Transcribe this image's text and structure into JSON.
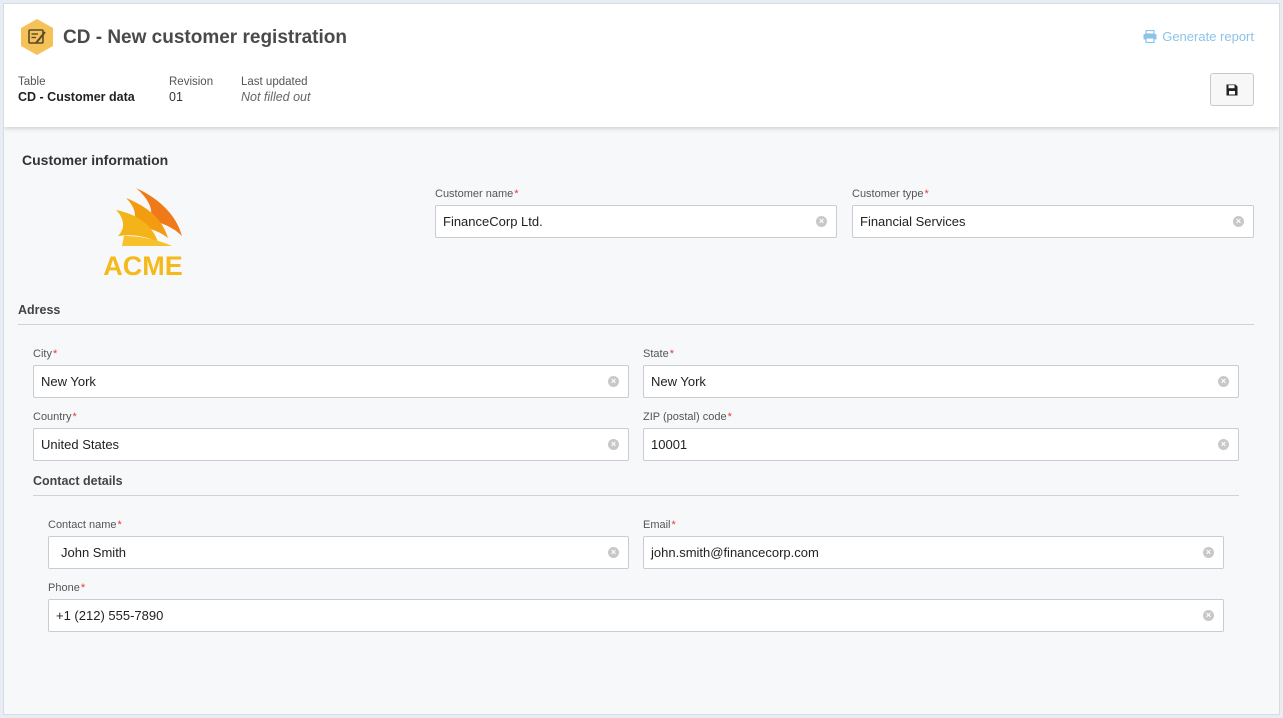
{
  "header": {
    "title": "CD - New customer registration",
    "generate_report": "Generate report",
    "meta": [
      {
        "label": "Table",
        "value": "CD - Customer data"
      },
      {
        "label": "Revision",
        "value": "01"
      },
      {
        "label": "Last updated",
        "value": "Not filled out"
      }
    ],
    "save_icon": "floppy-disk-icon"
  },
  "customer_info": {
    "title": "Customer information",
    "logo_text": "ACME",
    "customer_name": {
      "label": "Customer name",
      "value": "FinanceCorp Ltd."
    },
    "customer_type": {
      "label": "Customer type",
      "value": "Financial Services"
    }
  },
  "address": {
    "title": "Adress",
    "city": {
      "label": "City",
      "value": "New York"
    },
    "state": {
      "label": "State",
      "value": "New York"
    },
    "country": {
      "label": "Country",
      "value": "United States"
    },
    "zip": {
      "label": "ZIP (postal) code",
      "value": "10001"
    }
  },
  "contact": {
    "title": "Contact details",
    "contact_name": {
      "label": "Contact name",
      "value": "John Smith"
    },
    "email": {
      "label": "Email",
      "value": "john.smith@financecorp.com"
    },
    "phone": {
      "label": "Phone",
      "value": "+1 (212) 555-7890"
    }
  },
  "required_marker": "*",
  "colors": {
    "accent": "#8cc3ea",
    "required": "#e23b3b",
    "logo_orange": "#f39c12",
    "icon_yellow": "#f5c25a"
  }
}
